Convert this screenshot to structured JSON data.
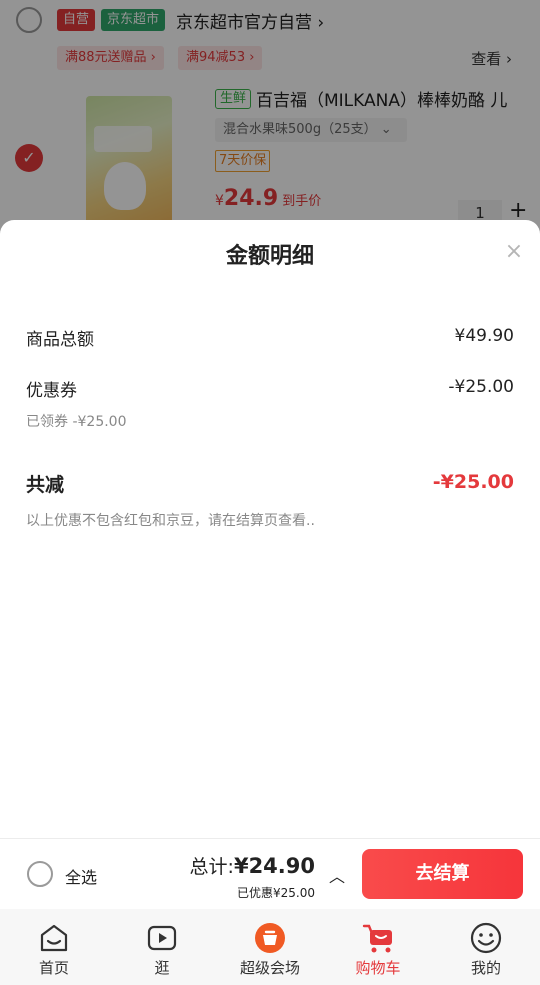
{
  "cart": {
    "shop": {
      "tag_self": "自营",
      "tag_jd": "京东超市",
      "name": "京东超市官方自营 ›"
    },
    "promos": [
      "满88元送赠品 ›",
      "满94减53 ›"
    ],
    "promo_view": "查看 ›",
    "item": {
      "tag_fresh": "生鲜",
      "title": "百吉福（MILKANA）棒棒奶酪 儿",
      "spec": "混合水果味500g（25支）  ⌄",
      "guarantee": "7天价保",
      "price_symbol": "¥",
      "price": "24.9",
      "price_note": "到手价",
      "quantity": "1",
      "check_icon": "✓",
      "plus": "+"
    }
  },
  "sheet": {
    "title": "金额明细",
    "close": "×",
    "goods_total_label": "商品总额",
    "goods_total_value": "¥49.90",
    "coupon_label": "优惠券",
    "coupon_value": "-¥25.00",
    "coupon_sub": "已领券 -¥25.00",
    "total_discount_label": "共减",
    "total_discount_value": "-¥25.00",
    "note": "以上优惠不包含红包和京豆，请在结算页查看.."
  },
  "checkout": {
    "select_all": "全选",
    "total_label": "总计:",
    "total_value": "¥24.90",
    "saved": "已优惠¥25.00",
    "caret": "︿",
    "button": "去结算"
  },
  "tabs": [
    {
      "label": "首页",
      "icon": "home-icon"
    },
    {
      "label": "逛",
      "icon": "video-icon"
    },
    {
      "label": "超级会场",
      "icon": "super-venue-icon"
    },
    {
      "label": "购物车",
      "icon": "cart-icon"
    },
    {
      "label": "我的",
      "icon": "profile-icon"
    }
  ],
  "colors": {
    "accent": "#e4393c",
    "jd_green": "#2fa86b",
    "fresh_green": "#3bb44a"
  }
}
